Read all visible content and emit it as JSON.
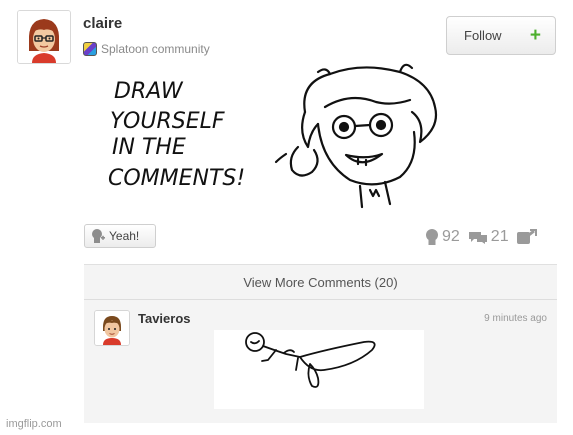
{
  "post": {
    "username": "claire",
    "community": "Splatoon community",
    "follow_label": "Follow",
    "drawing_text_lines": [
      "DRAW",
      "YOURSELF",
      "IN THE",
      "COMMENTS!"
    ],
    "yeah_label": "Yeah!",
    "yeah_count": "92",
    "comment_count": "21"
  },
  "comments": {
    "view_more": "View More Comments (20)",
    "item": {
      "username": "Tavieros",
      "time": "9 minutes ago"
    }
  },
  "watermark": "imgflip.com",
  "colors": {
    "follow_plus": "#4caf2c",
    "stat_gray": "#9a9a9a",
    "panel_bg": "#f4f4f4"
  }
}
